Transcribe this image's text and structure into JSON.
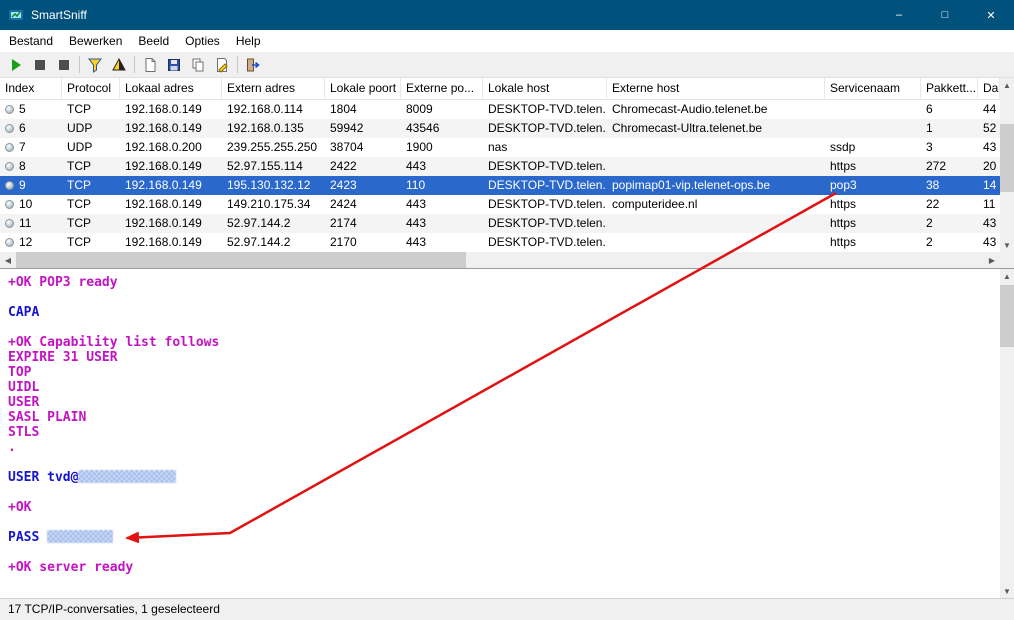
{
  "window": {
    "title": "SmartSniff",
    "controls": {
      "minimize": "–",
      "maximize": "□",
      "close": "✕"
    }
  },
  "menu": {
    "items": [
      "Bestand",
      "Bewerken",
      "Beeld",
      "Opties",
      "Help"
    ]
  },
  "toolbar": {
    "buttons": [
      "start-capture",
      "stop-capture",
      "pause-capture",
      "capture-filter",
      "display-filter",
      "clear-view",
      "save",
      "copy",
      "properties",
      "exit"
    ]
  },
  "table": {
    "columns": [
      "Index",
      "Protocol",
      "Lokaal adres",
      "Extern adres",
      "Lokale poort",
      "Externe po...",
      "Lokale host",
      "Externe host",
      "Servicenaam",
      "Pakkett...",
      "Da"
    ],
    "rows": [
      {
        "cells": [
          "5",
          "TCP",
          "192.168.0.149",
          "192.168.0.114",
          "1804",
          "8009",
          "DESKTOP-TVD.telen...",
          "Chromecast-Audio.telenet.be",
          "",
          "6",
          "44"
        ],
        "selected": false,
        "shaded": false
      },
      {
        "cells": [
          "6",
          "UDP",
          "192.168.0.149",
          "192.168.0.135",
          "59942",
          "43546",
          "DESKTOP-TVD.telen...",
          "Chromecast-Ultra.telenet.be",
          "",
          "1",
          "52"
        ],
        "selected": false,
        "shaded": true
      },
      {
        "cells": [
          "7",
          "UDP",
          "192.168.0.200",
          "239.255.255.250",
          "38704",
          "1900",
          "nas",
          "",
          "ssdp",
          "3",
          "43"
        ],
        "selected": false,
        "shaded": false
      },
      {
        "cells": [
          "8",
          "TCP",
          "192.168.0.149",
          "52.97.155.114",
          "2422",
          "443",
          "DESKTOP-TVD.telen...",
          "",
          "https",
          "272",
          "20"
        ],
        "selected": false,
        "shaded": true
      },
      {
        "cells": [
          "9",
          "TCP",
          "192.168.0.149",
          "195.130.132.12",
          "2423",
          "110",
          "DESKTOP-TVD.telen...",
          "popimap01-vip.telenet-ops.be",
          "pop3",
          "38",
          "14"
        ],
        "selected": true,
        "shaded": false
      },
      {
        "cells": [
          "10",
          "TCP",
          "192.168.0.149",
          "149.210.175.34",
          "2424",
          "443",
          "DESKTOP-TVD.telen...",
          "computeridee.nl",
          "https",
          "22",
          "11"
        ],
        "selected": false,
        "shaded": false
      },
      {
        "cells": [
          "11",
          "TCP",
          "192.168.0.149",
          "52.97.144.2",
          "2174",
          "443",
          "DESKTOP-TVD.telen...",
          "",
          "https",
          "2",
          "43"
        ],
        "selected": false,
        "shaded": true
      },
      {
        "cells": [
          "12",
          "TCP",
          "192.168.0.149",
          "52.97.144.2",
          "2170",
          "443",
          "DESKTOP-TVD.telen...",
          "",
          "https",
          "2",
          "43"
        ],
        "selected": false,
        "shaded": false
      }
    ]
  },
  "detail": {
    "lines": [
      {
        "text": "+OK POP3 ready",
        "side": "server"
      },
      {
        "text": "",
        "side": "server"
      },
      {
        "text": "CAPA",
        "side": "client"
      },
      {
        "text": "",
        "side": "server"
      },
      {
        "text": "+OK Capability list follows",
        "side": "server"
      },
      {
        "text": "EXPIRE 31 USER",
        "side": "server"
      },
      {
        "text": "TOP",
        "side": "server"
      },
      {
        "text": "UIDL",
        "side": "server"
      },
      {
        "text": "USER",
        "side": "server"
      },
      {
        "text": "SASL PLAIN",
        "side": "server"
      },
      {
        "text": "STLS",
        "side": "server"
      },
      {
        "text": ".",
        "side": "server"
      },
      {
        "text": "",
        "side": "server"
      },
      {
        "text": "USER tvd@",
        "side": "client",
        "redact": 98
      },
      {
        "text": "",
        "side": "server"
      },
      {
        "text": "+OK",
        "side": "server"
      },
      {
        "text": "",
        "side": "server"
      },
      {
        "text": "PASS ",
        "side": "client",
        "redact": 66
      },
      {
        "text": "",
        "side": "server"
      },
      {
        "text": "+OK server ready",
        "side": "server"
      }
    ]
  },
  "status": {
    "text": "17 TCP/IP-conversaties, 1 geselecteerd"
  },
  "colors": {
    "titlebar": "#00527c",
    "selection": "#2a68cc",
    "client": "#1515cd",
    "server": "#c413c4",
    "arrow": "#e01212"
  }
}
